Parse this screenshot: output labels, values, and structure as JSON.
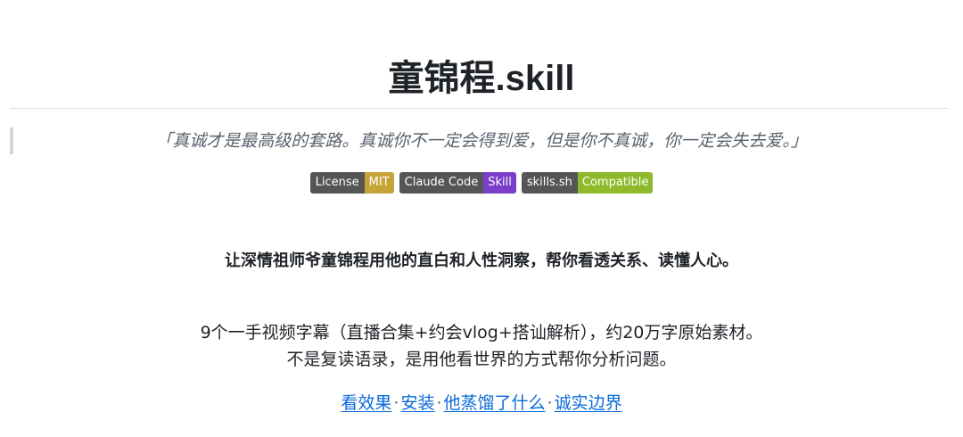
{
  "header": {
    "title_cn": "童锦程",
    "title_suffix": ".skill"
  },
  "quote": "「真诚才是最高级的套路。真诚你不一定会得到爱，但是你不真诚，你一定会失去爱。」",
  "badges": [
    {
      "label": "License",
      "value": "MIT",
      "color": "#c7a43a"
    },
    {
      "label": "Claude Code",
      "value": "Skill",
      "color": "#7a3ec8"
    },
    {
      "label": "skills.sh",
      "value": "Compatible",
      "color": "#8fba2c"
    }
  ],
  "tagline": "让深情祖师爷童锦程用他的直白和人性洞察，帮你看透关系、读懂人心。",
  "description": {
    "line1": "9个一手视频字幕（直播合集+约会vlog+搭讪解析），约20万字原始素材。",
    "line2": "不是复读语录，是用他看世界的方式帮你分析问题。"
  },
  "links": [
    {
      "label": "看效果"
    },
    {
      "label": "安装"
    },
    {
      "label": "他蒸馏了什么"
    },
    {
      "label": "诚实边界"
    }
  ],
  "link_separator": "·",
  "colors": {
    "link": "#0969da",
    "badge_label_bg": "#555555",
    "text": "#1f2328",
    "muted": "#59636e"
  }
}
